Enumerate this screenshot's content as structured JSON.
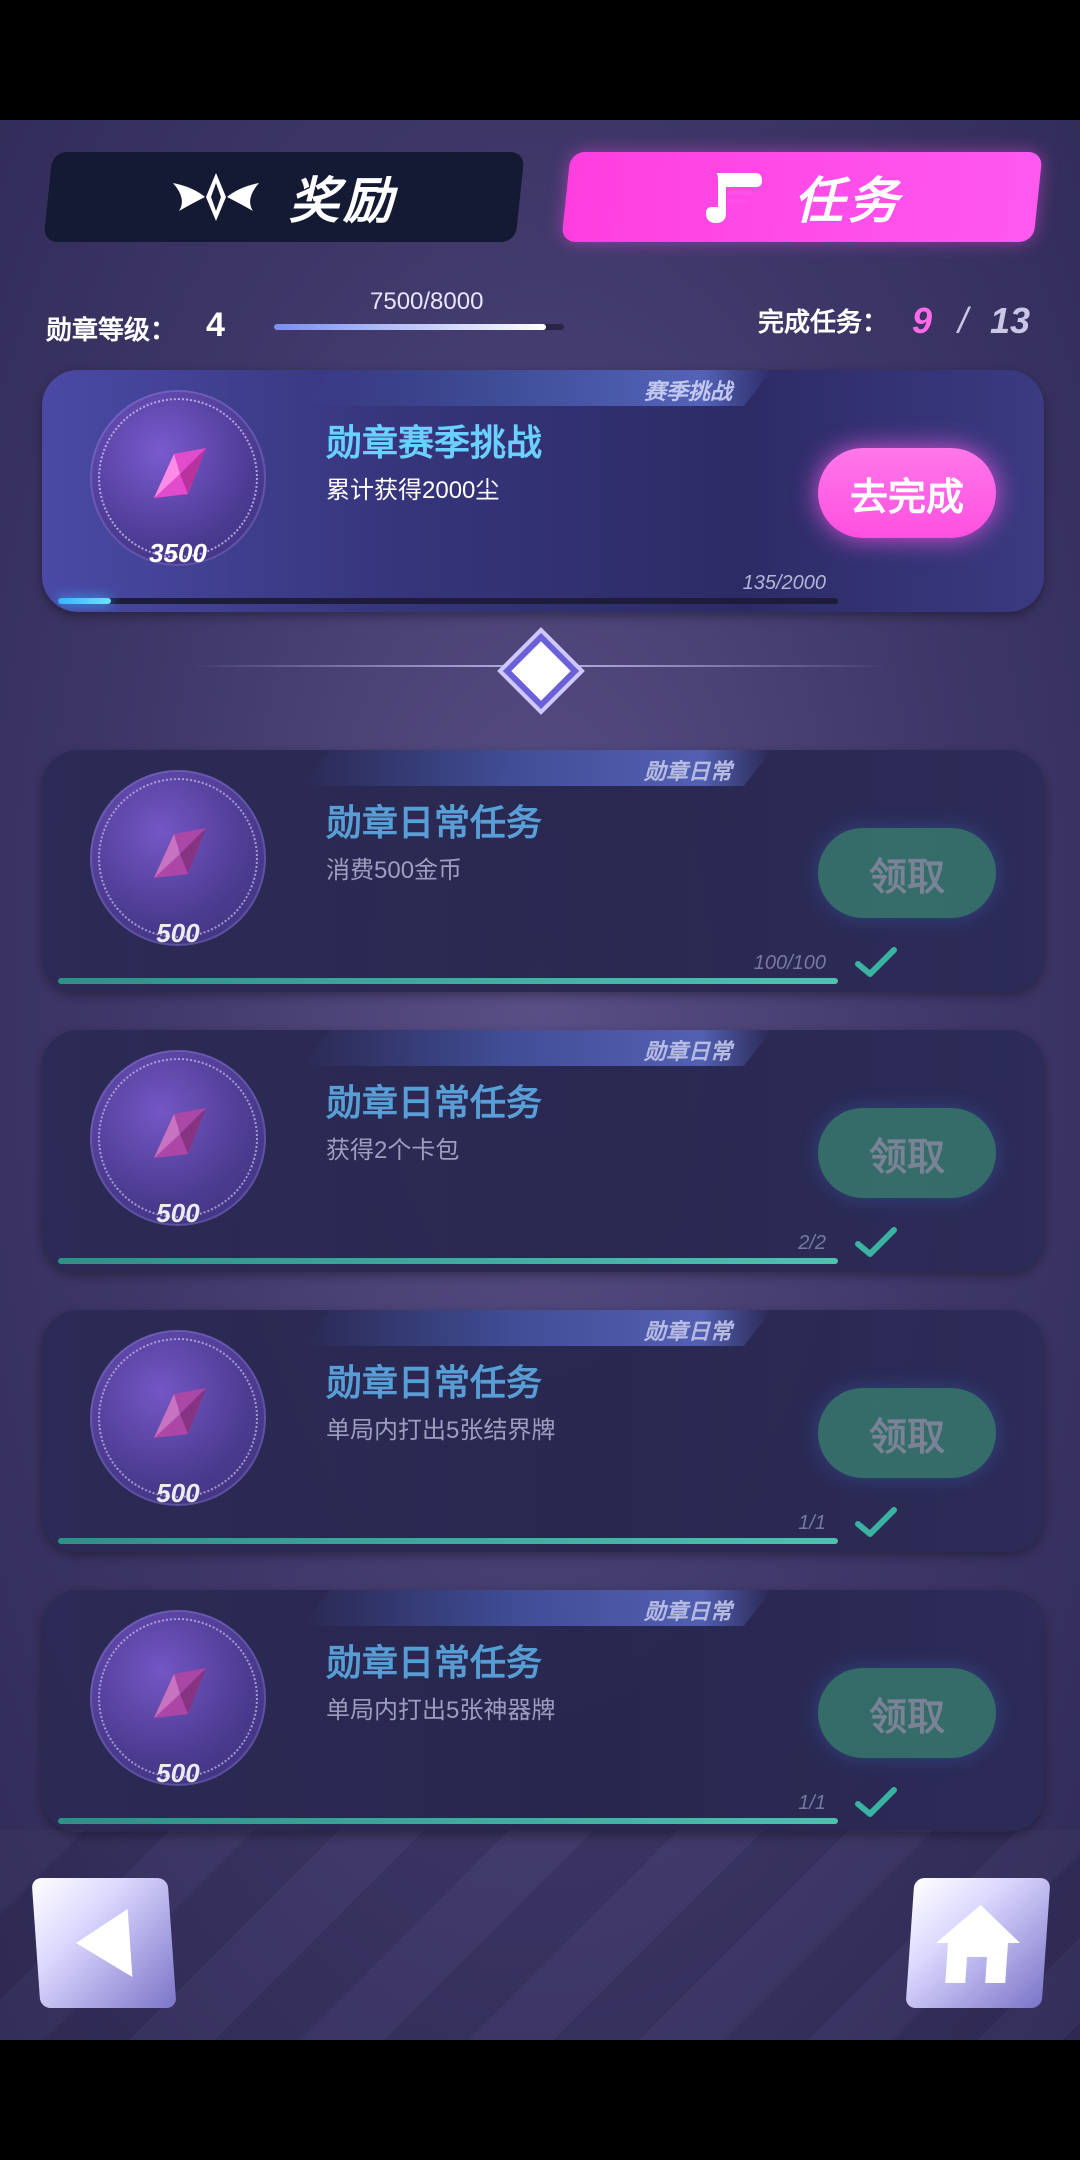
{
  "tabs": {
    "rewards_label": "奖励",
    "tasks_label": "任务",
    "active": "tasks"
  },
  "header": {
    "level_label": "勋章等级：",
    "level": "4",
    "xp_text": "7500/8000",
    "xp_fraction": 0.9375,
    "completed_label": "完成任务：",
    "completed": "9",
    "separator": "/",
    "total": "13"
  },
  "season": {
    "tag": "赛季挑战",
    "title": "勋章赛季挑战",
    "desc": "累计获得2000尘",
    "reward": "3500",
    "button": "去完成",
    "progress_text": "135/2000",
    "progress_fraction": 0.0675
  },
  "tasks": [
    {
      "tag": "勋章日常",
      "title": "勋章日常任务",
      "desc": "消费500金币",
      "reward": "500",
      "button": "领取",
      "progress_text": "100/100",
      "progress_fraction": 1
    },
    {
      "tag": "勋章日常",
      "title": "勋章日常任务",
      "desc": "获得2个卡包",
      "reward": "500",
      "button": "领取",
      "progress_text": "2/2",
      "progress_fraction": 1
    },
    {
      "tag": "勋章日常",
      "title": "勋章日常任务",
      "desc": "单局内打出5张结界牌",
      "reward": "500",
      "button": "领取",
      "progress_text": "1/1",
      "progress_fraction": 1
    },
    {
      "tag": "勋章日常",
      "title": "勋章日常任务",
      "desc": "单局内打出5张神器牌",
      "reward": "500",
      "button": "领取",
      "progress_text": "1/1",
      "progress_fraction": 1
    }
  ],
  "icons": {
    "rewards_tab": "winged-emblem-icon",
    "tasks_tab": "scroll-icon",
    "medal": "pink-gem-icon",
    "complete": "checkmark-icon",
    "back": "back-arrow-icon",
    "home": "home-icon"
  },
  "colors": {
    "active_tab": "#ff4fe6",
    "claim_button": "#377f6e",
    "go_button": "#ff60e6"
  }
}
